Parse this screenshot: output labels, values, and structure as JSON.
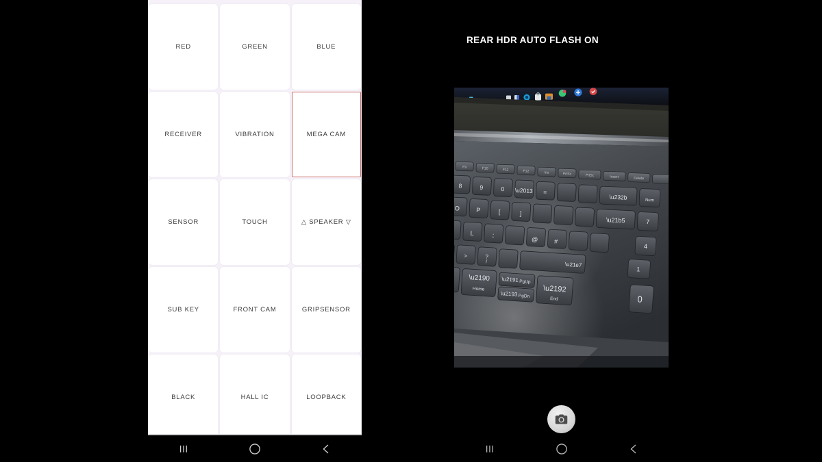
{
  "left_panel": {
    "name": "factory-test-grid",
    "background_color": "#f6f1f8",
    "cell_color": "#ffffff",
    "selected_color": "#cd7068",
    "cells": [
      {
        "label": "RED",
        "selected": false
      },
      {
        "label": "GREEN",
        "selected": false
      },
      {
        "label": "BLUE",
        "selected": false
      },
      {
        "label": "RECEIVER",
        "selected": false
      },
      {
        "label": "VIBRATION",
        "selected": false
      },
      {
        "label": "MEGA CAM",
        "selected": true
      },
      {
        "label": "SENSOR",
        "selected": false
      },
      {
        "label": "TOUCH",
        "selected": false
      },
      {
        "label": "△ SPEAKER ▽",
        "selected": false
      },
      {
        "label": "SUB KEY",
        "selected": false
      },
      {
        "label": "FRONT CAM",
        "selected": false
      },
      {
        "label": "GRIPSENSOR",
        "selected": false
      },
      {
        "label": "BLACK",
        "selected": false
      },
      {
        "label": "HALL IC",
        "selected": false
      },
      {
        "label": "LOOPBACK",
        "selected": false
      }
    ],
    "navbar": {
      "recents": "recents-icon",
      "home": "home-icon",
      "back": "back-icon"
    }
  },
  "right_panel": {
    "name": "camera-test-screen",
    "title": "REAR HDR AUTO FLASH ON",
    "title_color": "#ffffff",
    "background_color": "#000000",
    "preview": {
      "name": "camera-preview",
      "description": "Photo of a dark laptop keyboard with a Windows taskbar visible on the screen above"
    },
    "shutter_button": {
      "icon": "camera-icon",
      "label": "Shutter"
    },
    "navbar": {
      "recents": "recents-icon",
      "home": "home-icon",
      "back": "back-icon"
    }
  }
}
